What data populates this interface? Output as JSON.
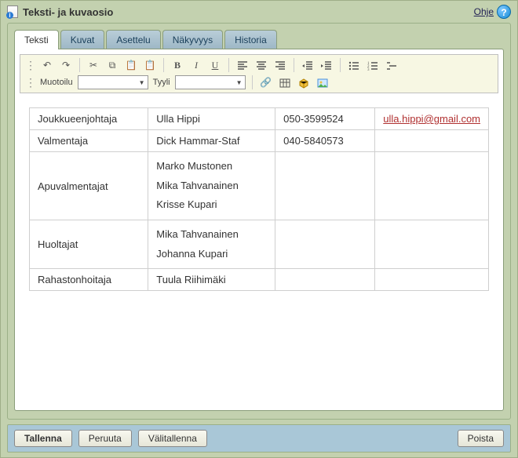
{
  "window": {
    "title": "Teksti- ja kuvaosio",
    "help_label": "Ohje"
  },
  "tabs": [
    {
      "label": "Teksti",
      "active": true
    },
    {
      "label": "Kuvat",
      "active": false
    },
    {
      "label": "Asettelu",
      "active": false
    },
    {
      "label": "Näkyvyys",
      "active": false
    },
    {
      "label": "Historia",
      "active": false
    }
  ],
  "toolbar": {
    "format_label": "Muotoilu",
    "style_label": "Tyyli",
    "format_value": "",
    "style_value": ""
  },
  "table": {
    "rows": [
      {
        "role": "Joukkueenjohtaja",
        "names": [
          "Ulla Hippi"
        ],
        "phone": "050-3599524",
        "email": "ulla.hippi@gmail.com"
      },
      {
        "role": "Valmentaja",
        "names": [
          "Dick Hammar-Staf"
        ],
        "phone": "040-5840573",
        "email": ""
      },
      {
        "role": "Apuvalmentajat",
        "names": [
          "Marko Mustonen",
          "Mika Tahvanainen",
          "Krisse Kupari"
        ],
        "phone": "",
        "email": ""
      },
      {
        "role": "Huoltajat",
        "names": [
          "Mika Tahvanainen",
          "Johanna Kupari"
        ],
        "phone": "",
        "email": ""
      },
      {
        "role": "Rahastonhoitaja",
        "names": [
          "Tuula Riihimäki"
        ],
        "phone": "",
        "email": ""
      }
    ]
  },
  "footer": {
    "save": "Tallenna",
    "cancel": "Peruuta",
    "savedraft": "Välitallenna",
    "delete": "Poista"
  }
}
